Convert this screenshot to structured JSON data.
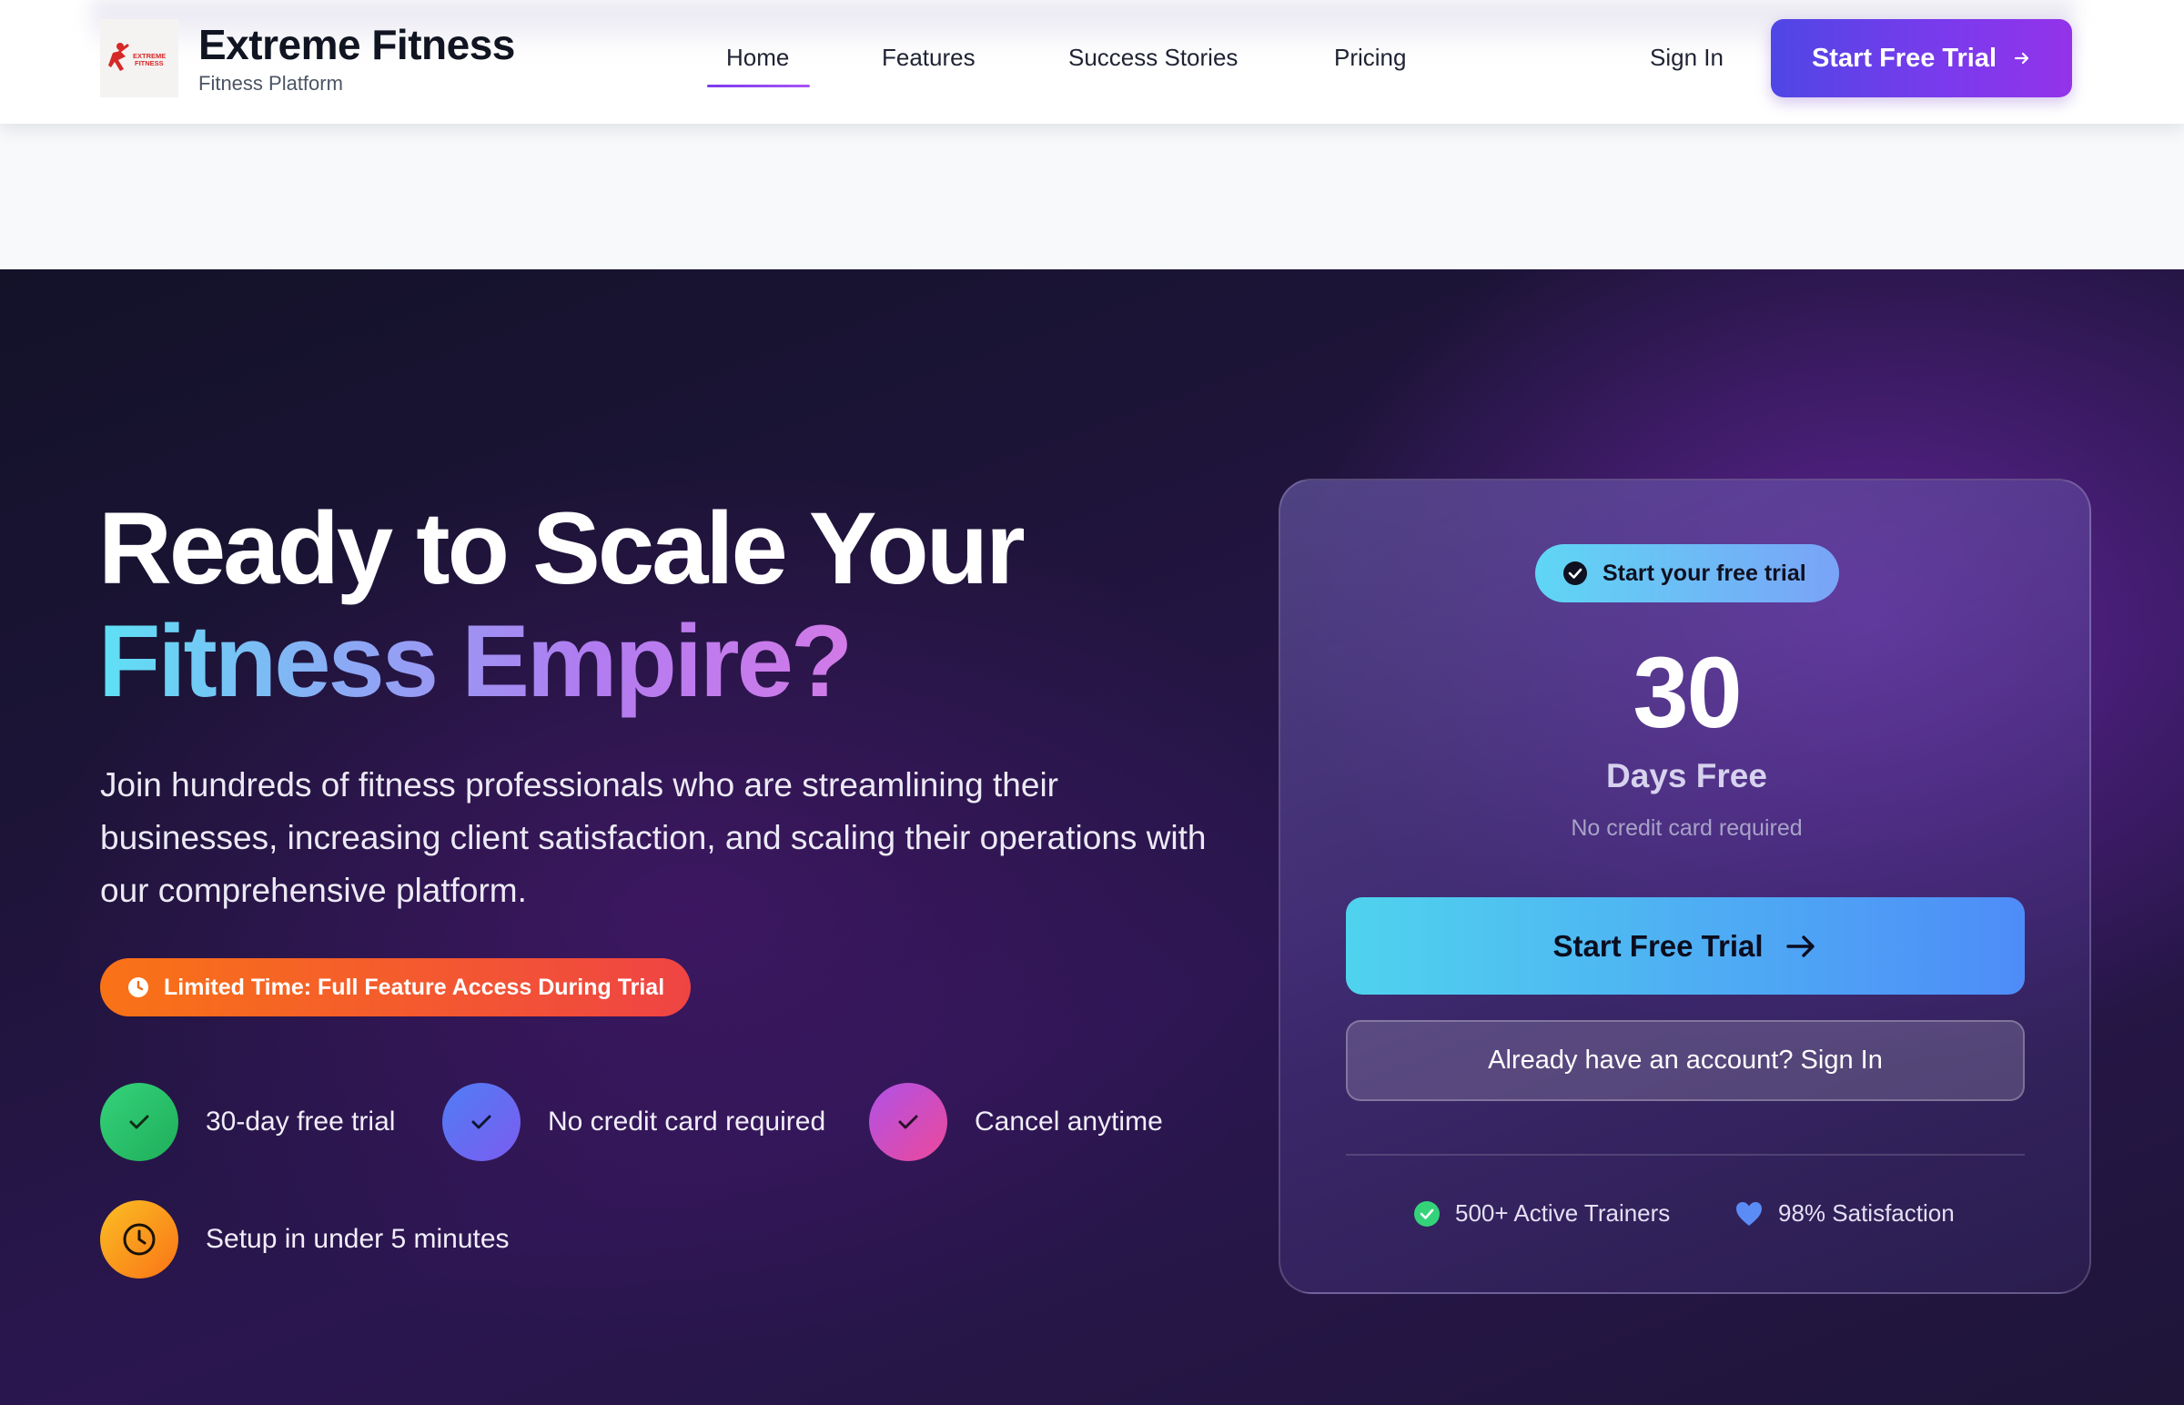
{
  "nav": {
    "brand_name": "Extreme Fitness",
    "brand_sub": "Fitness Platform",
    "logo_text_1": "EXTREME",
    "logo_text_2": "FITNESS",
    "links": [
      "Home",
      "Features",
      "Success Stories",
      "Pricing"
    ],
    "active_link": "Home",
    "sign_in": "Sign In",
    "cta": "Start Free Trial",
    "cta_icon": "arrow-right-icon"
  },
  "hero": {
    "title_line1": "Ready to Scale Your",
    "title_line2": "Fitness Empire?",
    "description": "Join hundreds of fitness professionals who are streamlining their businesses, increasing client satisfaction, and scaling their operations with our comprehensive platform.",
    "limited_badge": "Limited Time: Full Feature Access During Trial",
    "features": [
      {
        "label": "30-day free trial",
        "icon": "check-icon",
        "color": "#22c55e"
      },
      {
        "label": "No credit card required",
        "icon": "check-icon",
        "color": "#6366f1"
      },
      {
        "label": "Cancel anytime",
        "icon": "check-icon",
        "color": "#d946ef"
      },
      {
        "label": "Setup in under 5 minutes",
        "icon": "clock-icon",
        "color": "#f59e0b"
      }
    ]
  },
  "card": {
    "pill": "Start your free trial",
    "days_number": "30",
    "days_label": "Days Free",
    "no_card": "No credit card required",
    "cta": "Start Free Trial",
    "signin": "Already have an account? Sign In",
    "stats": [
      {
        "label": "500+ Active Trainers",
        "icon": "check-circle-icon"
      },
      {
        "label": "98% Satisfaction",
        "icon": "heart-icon"
      }
    ]
  },
  "colors": {
    "accent_purple": "#7c3aed",
    "accent_cyan": "#4fd3ee",
    "hero_bg": "#1d1438",
    "badge_orange": "#f97316"
  }
}
